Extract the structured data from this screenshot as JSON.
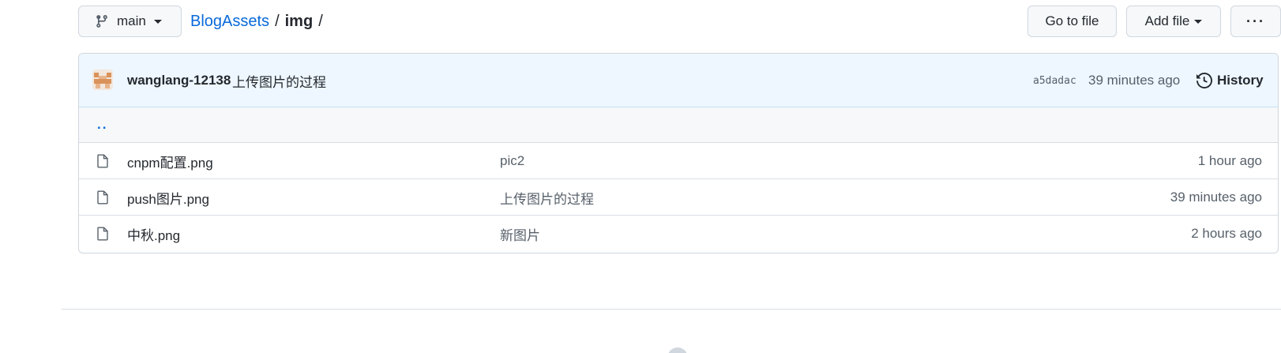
{
  "toolbar": {
    "branch_label": "main",
    "go_to_file": "Go to file",
    "add_file": "Add file",
    "more": "···"
  },
  "breadcrumb": {
    "repo": "BlogAssets",
    "sep1": "/",
    "folder": "img",
    "sep2": "/"
  },
  "commit": {
    "author": "wanglang-12138",
    "message": "上传图片的过程",
    "sha": "a5dadac",
    "time": "39 minutes ago",
    "history_label": "History"
  },
  "parent_dir": "..",
  "files": [
    {
      "name": "cnpm配置.png",
      "message": "pic2",
      "age": "1 hour ago"
    },
    {
      "name": "push图片.png",
      "message": "上传图片的过程",
      "age": "39 minutes ago"
    },
    {
      "name": "中秋.png",
      "message": "新图片",
      "age": "2 hours ago"
    }
  ],
  "colors": {
    "link": "#0969da",
    "commit_bg": "#eef7ff",
    "border": "#d0d7de",
    "muted": "#57606a"
  }
}
